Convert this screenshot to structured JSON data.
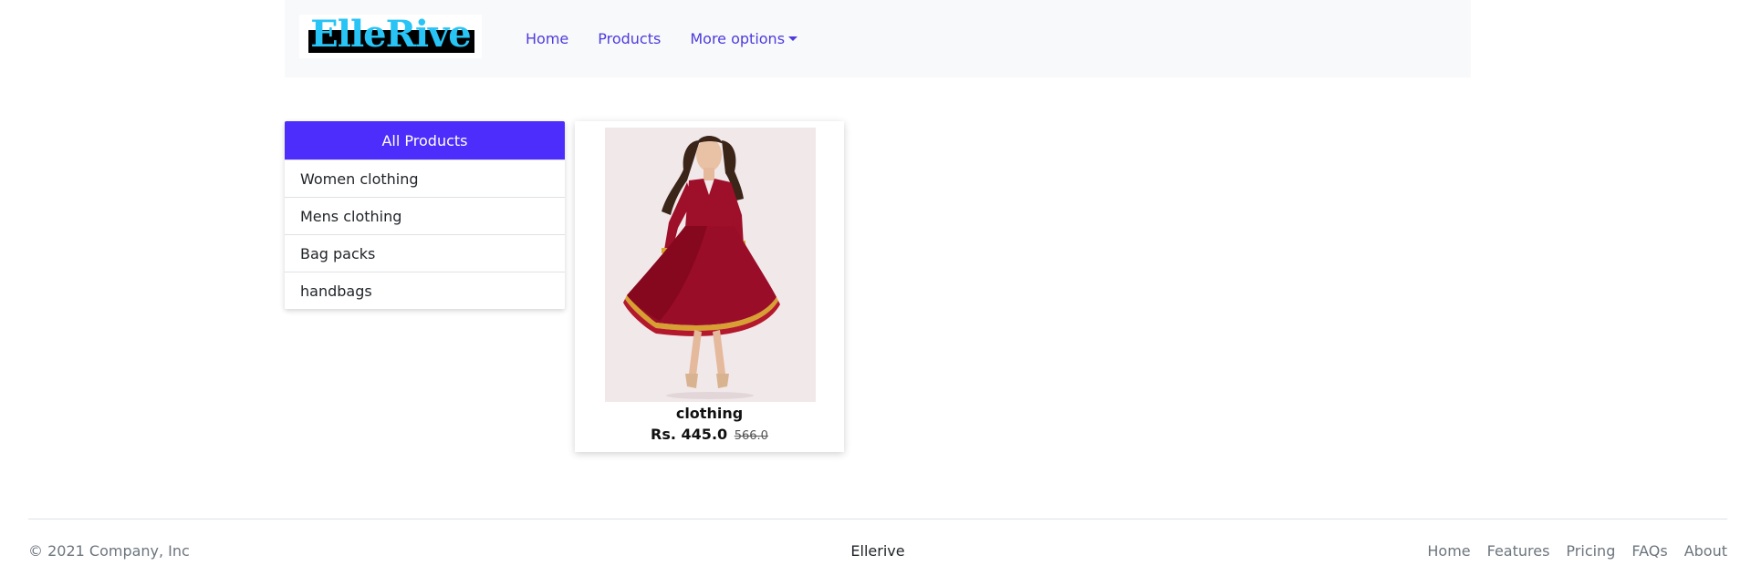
{
  "navbar": {
    "logo_text": "ElleRive",
    "links": [
      {
        "label": "Home"
      },
      {
        "label": "Products"
      },
      {
        "label": "More options"
      }
    ],
    "link_color": "#4e3bde"
  },
  "sidebar": {
    "active_label": "All Products",
    "active_color": "#4d2dfb",
    "items": [
      {
        "label": "Women clothing"
      },
      {
        "label": "Mens clothing"
      },
      {
        "label": "Bag packs"
      },
      {
        "label": "handbags"
      }
    ]
  },
  "products": [
    {
      "title": "clothing",
      "price": "Rs. 445.0",
      "old_price": "566.0",
      "image": "red-dress-photo"
    }
  ],
  "footer": {
    "copyright": "© 2021 Company, Inc",
    "brand": "Ellerive",
    "links": [
      {
        "label": "Home"
      },
      {
        "label": "Features"
      },
      {
        "label": "Pricing"
      },
      {
        "label": "FAQs"
      },
      {
        "label": "About"
      }
    ]
  }
}
